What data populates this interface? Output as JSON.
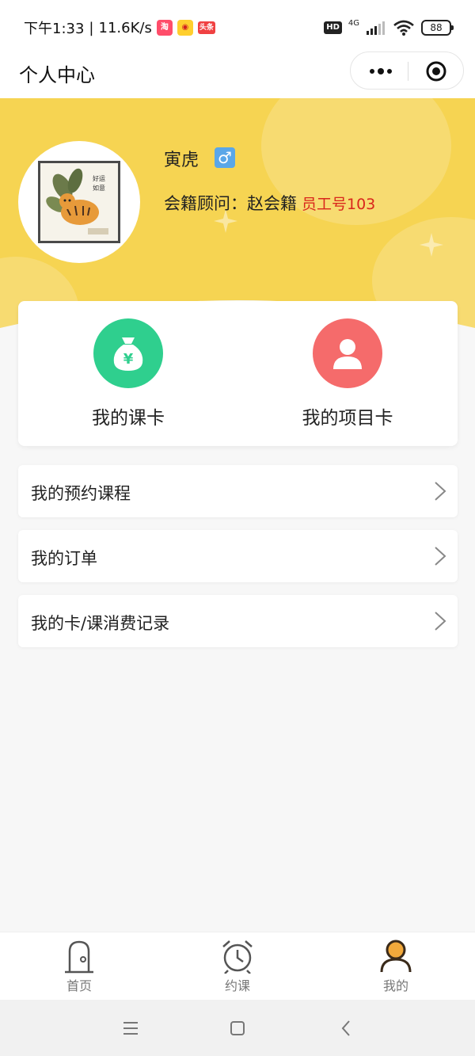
{
  "status_bar": {
    "time": "下午1:33",
    "speed": "11.6K/s",
    "app_icons": [
      "taobao-icon",
      "weibo-icon",
      "toutiao-icon"
    ],
    "hd": "HD",
    "network": "4G",
    "battery": "88"
  },
  "nav": {
    "title": "个人中心"
  },
  "profile": {
    "name": "寅虎",
    "gender_symbol": "♂",
    "advisor_label": "会籍顾问：",
    "advisor_name": "赵会籍",
    "employee_no": "员工号103"
  },
  "quick": {
    "course_card": "我的课卡",
    "project_card": "我的项目卡"
  },
  "menu": {
    "items": [
      {
        "label": "我的预约课程"
      },
      {
        "label": "我的订单"
      },
      {
        "label": "我的卡/课消费记录"
      }
    ]
  },
  "tabbar": {
    "tabs": [
      {
        "label": "首页"
      },
      {
        "label": "约课"
      },
      {
        "label": "我的"
      }
    ]
  },
  "colors": {
    "header_yellow": "#f6d452",
    "green": "#2fcf8e",
    "red": "#f56b6b",
    "empno_red": "#d9261c",
    "tab_active_orange": "#f2a93b"
  }
}
